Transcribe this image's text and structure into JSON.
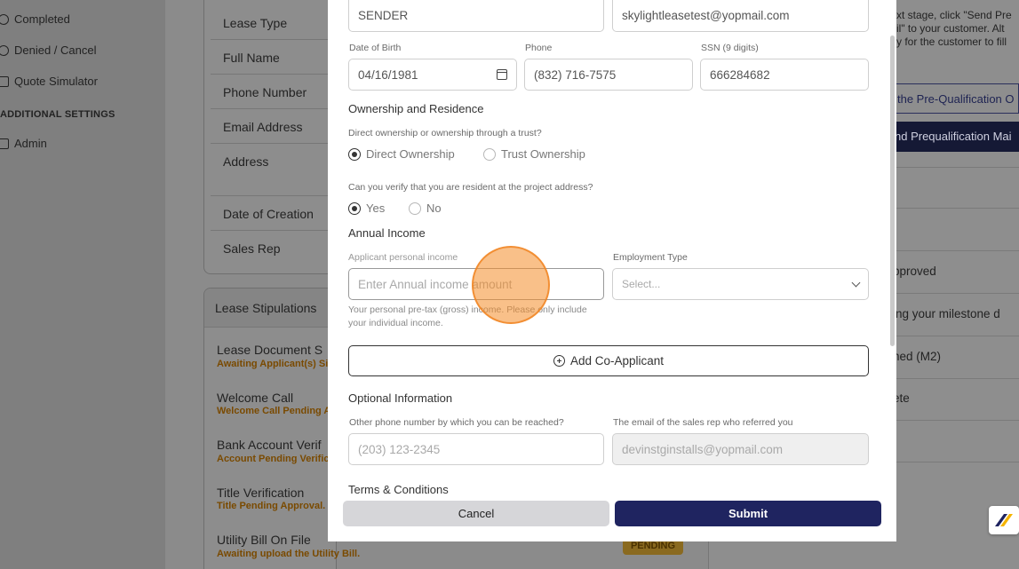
{
  "sidebar": {
    "items": [
      {
        "label": "Completed",
        "icon": "check-circle-icon"
      },
      {
        "label": "Denied / Cancel",
        "icon": "x-circle-icon"
      },
      {
        "label": "Quote Simulator",
        "icon": "calculator-icon"
      }
    ],
    "section_title": "ADDITIONAL SETTINGS",
    "admin_label": "Admin"
  },
  "details": {
    "fields": [
      "Lease Type",
      "Full Name",
      "Phone Number",
      "Email Address",
      "Address",
      "Date of Creation",
      "Sales Rep"
    ]
  },
  "stipulations": {
    "title": "Lease Stipulations",
    "items": [
      {
        "label": "Lease Document S",
        "status": "Awaiting Applicant(s) Si"
      },
      {
        "label": "Welcome Call",
        "status": "Welcome Call Pending A"
      },
      {
        "label": "Bank Account Verif",
        "status": "Account Pending Verific"
      },
      {
        "label": "Title Verification",
        "status": "Title Pending Approval."
      },
      {
        "label": "Utility Bill On File",
        "status": "Awaiting upload the Utility Bill."
      }
    ],
    "pending_badge": "PENDING"
  },
  "right_panel": {
    "info_lines": [
      "xt stage, click \"Send Pre",
      "il\" to your customer. Alt",
      "y for the customer to fill"
    ],
    "btn_pre_qual": "the Pre-Qualification O",
    "btn_send_prequal": "nd Prequalification Mai",
    "items": [
      "pproved",
      "ing your milestone d",
      "ned (M2)",
      "ete"
    ]
  },
  "form": {
    "name_value": "SENDER",
    "email_value": "skylightleasetest@yopmail.com",
    "dob_label": "Date of Birth",
    "dob_value": "04/16/1981",
    "phone_label": "Phone",
    "phone_value": "(832) 716-7575",
    "ssn_label": "SSN (9 digits)",
    "ssn_value": "666284682",
    "ownership_section": "Ownership and Residence",
    "ownership_question": "Direct ownership or ownership through a trust?",
    "ownership_direct": "Direct Ownership",
    "ownership_trust": "Trust Ownership",
    "resident_question": "Can you verify that you are resident at the project address?",
    "resident_yes": "Yes",
    "resident_no": "No",
    "income_section": "Annual Income",
    "income_label": "Applicant personal income",
    "income_placeholder": "Enter Annual income amount",
    "employment_label": "Employment Type",
    "employment_placeholder": "Select...",
    "income_help": "Your personal pre-tax (gross) income. Please only include your individual income.",
    "add_co_applicant": "Add Co-Applicant",
    "optional_section": "Optional Information",
    "other_phone_label": "Other phone number by which you can be reached?",
    "other_phone_placeholder": "(203) 123-2345",
    "sales_rep_email_label": "The email of the sales rep who referred you",
    "sales_rep_email_value": "devinstginstalls@yopmail.com",
    "terms_section": "Terms & Conditions"
  },
  "footer": {
    "cancel_label": "Cancel",
    "submit_label": "Submit"
  },
  "colors": {
    "primary": "#1f2460",
    "pending": "#f5a623",
    "cursor_highlight": "#f48c28"
  }
}
